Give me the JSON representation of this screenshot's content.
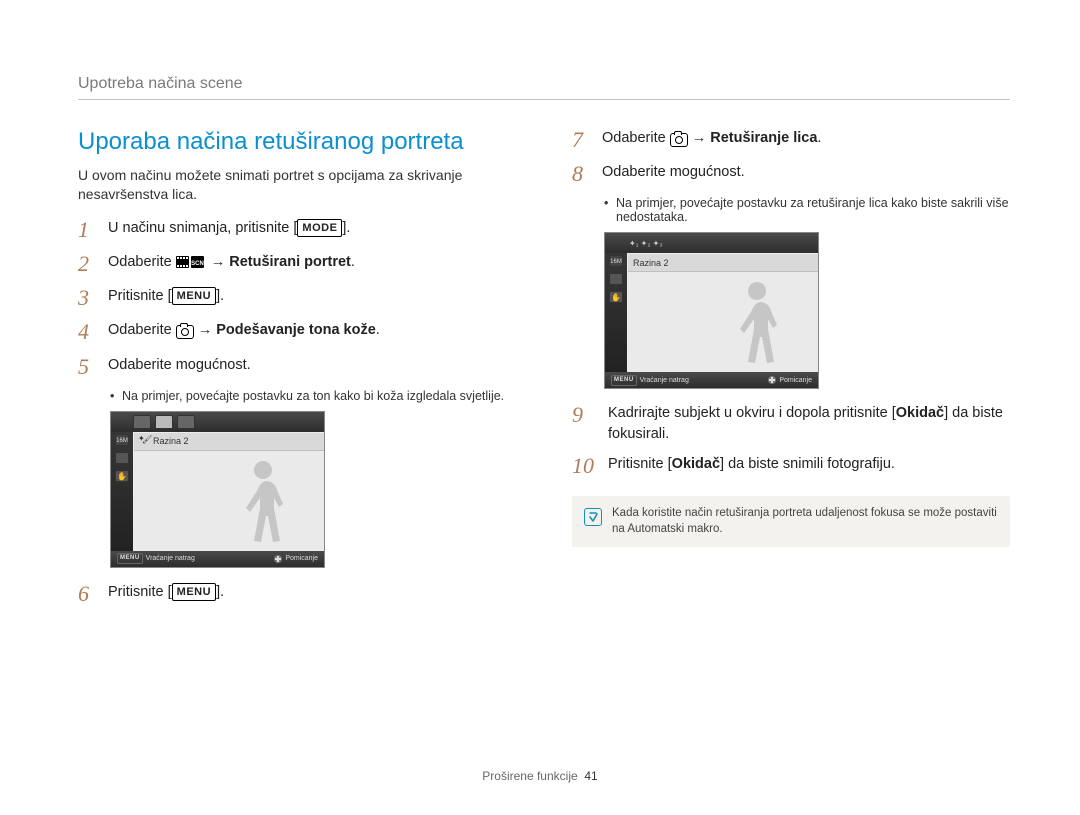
{
  "breadcrumb": "Upotreba načina scene",
  "title": "Uporaba načina retuširanog portreta",
  "intro": "U ovom načinu možete snimati portret s opcijama za skrivanje nesavršenstva lica.",
  "steps": {
    "1": {
      "pre": "U načinu snimanja, pritisnite [",
      "key": "MODE",
      "post": "]."
    },
    "2": {
      "pre": "Odaberite ",
      "icon": "scn",
      "arrow": "→ ",
      "bold": "Retuširani portret",
      "post": "."
    },
    "3": {
      "pre": "Pritisnite [",
      "key": "MENU",
      "post": "]."
    },
    "4": {
      "pre": "Odaberite ",
      "icon": "cam",
      "arrow": " → ",
      "bold": "Podešavanje tona kože",
      "post": "."
    },
    "5": {
      "text": "Odaberite mogućnost.",
      "bullet": "Na primjer, povećajte postavku za ton kako bi koža izgledala svjetlije."
    },
    "6": {
      "pre": "Pritisnite [",
      "key": "MENU",
      "post": "]."
    },
    "7": {
      "pre": "Odaberite ",
      "icon": "cam",
      "arrow": " → ",
      "bold": "Retuširanje lica",
      "post": "."
    },
    "8": {
      "text": "Odaberite mogućnost.",
      "bullet": "Na primjer, povećajte postavku za retuširanje lica kako biste sakrili više nedostataka."
    },
    "9": {
      "pre": "Kadrirajte subjekt u okviru i dopola pritisnite [",
      "bold": "Okidač",
      "post": "] da biste fokusirali."
    },
    "10": {
      "pre": "Pritisnite [",
      "bold": "Okidač",
      "post": "] da biste snimili fotografiju."
    }
  },
  "preview": {
    "level_label": "Razina 2",
    "footer_back_key": "MENU",
    "footer_back": "Vraćanje natrag",
    "footer_move": "Pomicanje"
  },
  "note": "Kada koristite način retuširanja portreta udaljenost fokusa se može postaviti na Automatski makro.",
  "footer": {
    "section": "Proširene funkcije",
    "page": "41"
  }
}
